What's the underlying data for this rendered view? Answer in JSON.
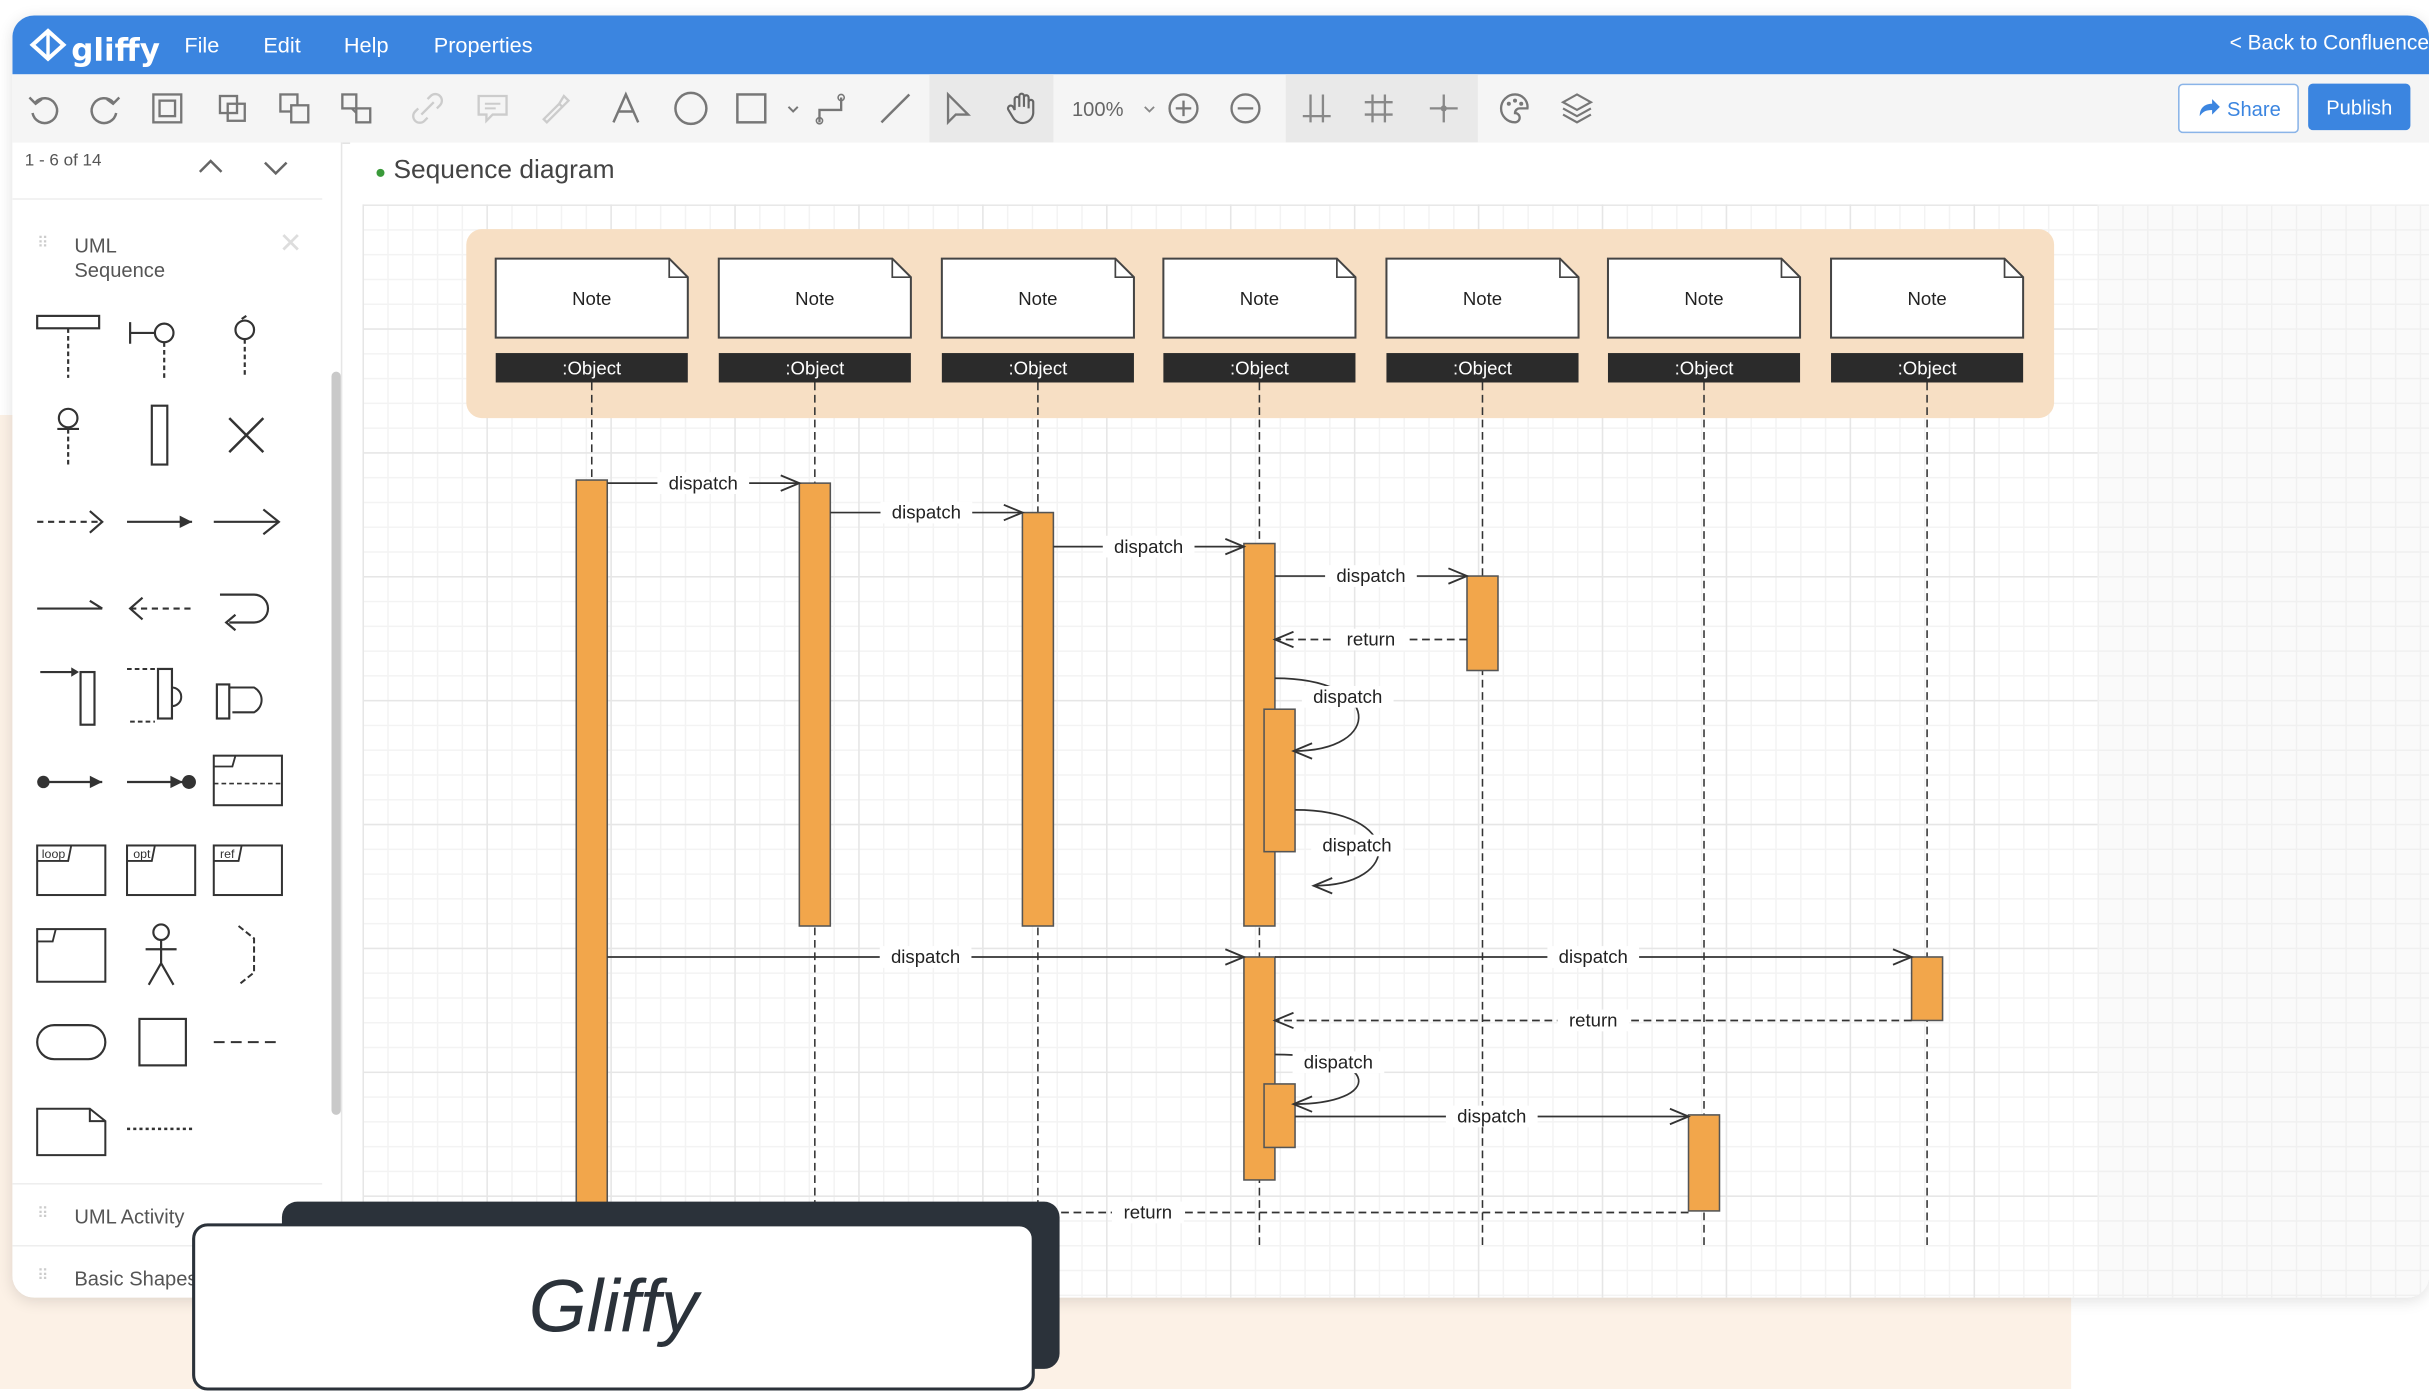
{
  "app": {
    "logo_text": "gliffy",
    "menus": [
      "File",
      "Edit",
      "Help",
      "Properties"
    ],
    "back_link": "< Back to Confluence"
  },
  "toolbar": {
    "icons": [
      "undo-icon",
      "redo-icon",
      "group-icon",
      "ungroup-icon",
      "bring-front-icon",
      "send-back-icon",
      "link-icon",
      "comment-icon",
      "format-painter-icon",
      "text-icon",
      "ellipse-icon",
      "rectangle-icon",
      "connector-icon",
      "line-icon",
      "pointer-icon",
      "hand-icon",
      "zoom-in-icon",
      "zoom-out-icon",
      "guides-icon",
      "grid-icon",
      "snap-icon",
      "theme-icon",
      "layers-icon"
    ],
    "zoom": "100%",
    "share_label": "Share",
    "publish_label": "Publish"
  },
  "sidebar": {
    "pager": "1 - 6 of 14",
    "libraries": [
      {
        "name": "UML\nSequence"
      },
      {
        "name": "UML Activity"
      },
      {
        "name": "Basic Shapes"
      }
    ],
    "frame_labels": [
      "loop",
      "opt",
      "ref"
    ]
  },
  "canvas": {
    "page_title": "Sequence diagram",
    "diagram": {
      "participants": [
        {
          "note": "Note",
          "object": ":Object"
        },
        {
          "note": "Note",
          "object": ":Object"
        },
        {
          "note": "Note",
          "object": ":Object"
        },
        {
          "note": "Note",
          "object": ":Object"
        },
        {
          "note": "Note",
          "object": ":Object"
        },
        {
          "note": "Note",
          "object": ":Object"
        },
        {
          "note": "Note",
          "object": ":Object"
        }
      ],
      "messages": [
        {
          "label": "dispatch",
          "from": 1,
          "to": 2,
          "kind": "call"
        },
        {
          "label": "dispatch",
          "from": 2,
          "to": 3,
          "kind": "call"
        },
        {
          "label": "dispatch",
          "from": 3,
          "to": 4,
          "kind": "call"
        },
        {
          "label": "dispatch",
          "from": 4,
          "to": 5,
          "kind": "call"
        },
        {
          "label": "return",
          "from": 5,
          "to": 4,
          "kind": "return"
        },
        {
          "label": "dispatch",
          "from": 4,
          "to": 4,
          "kind": "self"
        },
        {
          "label": "dispatch",
          "from": 4,
          "to": 4,
          "kind": "self"
        },
        {
          "label": "dispatch",
          "from": 1,
          "to": 4,
          "kind": "call"
        },
        {
          "label": "dispatch",
          "from": 4,
          "to": 7,
          "kind": "call"
        },
        {
          "label": "return",
          "from": 7,
          "to": 4,
          "kind": "return"
        },
        {
          "label": "dispatch",
          "from": 4,
          "to": 4,
          "kind": "self"
        },
        {
          "label": "dispatch",
          "from": 4,
          "to": 6,
          "kind": "call"
        },
        {
          "label": "return",
          "from": 6,
          "to": 1,
          "kind": "return"
        }
      ]
    }
  },
  "caption": "Gliffy",
  "colors": {
    "brand_blue": "#3b85e0",
    "activation_orange": "#f2a64b",
    "header_band": "#f7dfc4",
    "object_bar": "#2b2b2b",
    "background_peach": "#fcf1e6",
    "caption_dark": "#2b323a"
  }
}
